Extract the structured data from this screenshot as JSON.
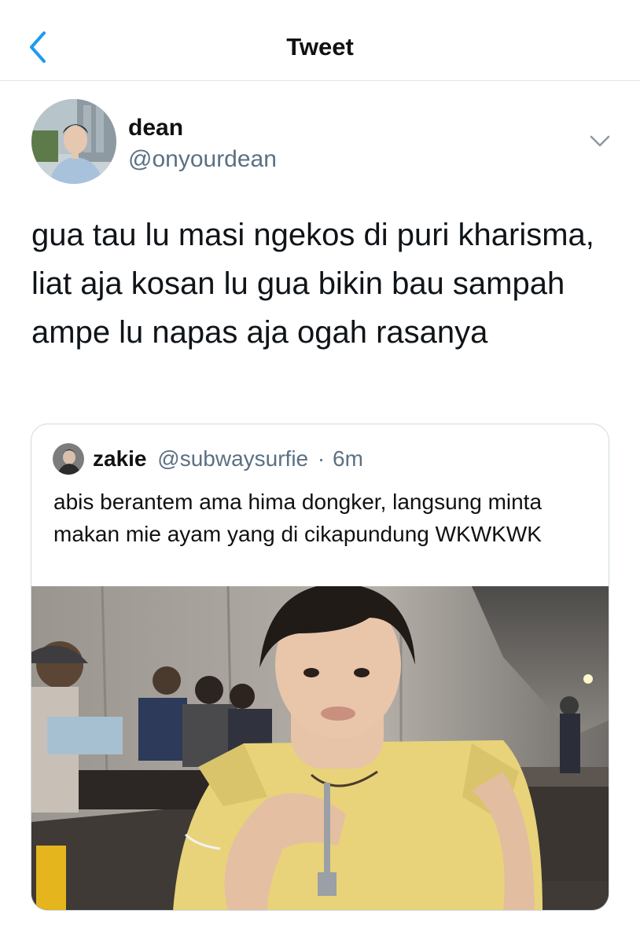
{
  "header": {
    "title": "Tweet"
  },
  "tweet": {
    "name": "dean",
    "handle": "@onyourdean",
    "text": "gua tau lu masi ngekos di puri kharisma, liat aja kosan lu gua bikin bau sampah ampe lu napas aja ogah rasanya"
  },
  "quote": {
    "name": "zakie",
    "handle": "@subwaysurfie",
    "separator": "·",
    "time": "6m",
    "text": "abis berantem ama hima dongker, langsung minta makan mie ayam yang di cikapundung WKWKWK"
  },
  "colors": {
    "accent": "#1d9bf0",
    "secondary_text": "#5b7083",
    "border": "#cfd9de"
  },
  "icons": {
    "back": "chevron-left-icon",
    "more": "chevron-down-icon"
  }
}
